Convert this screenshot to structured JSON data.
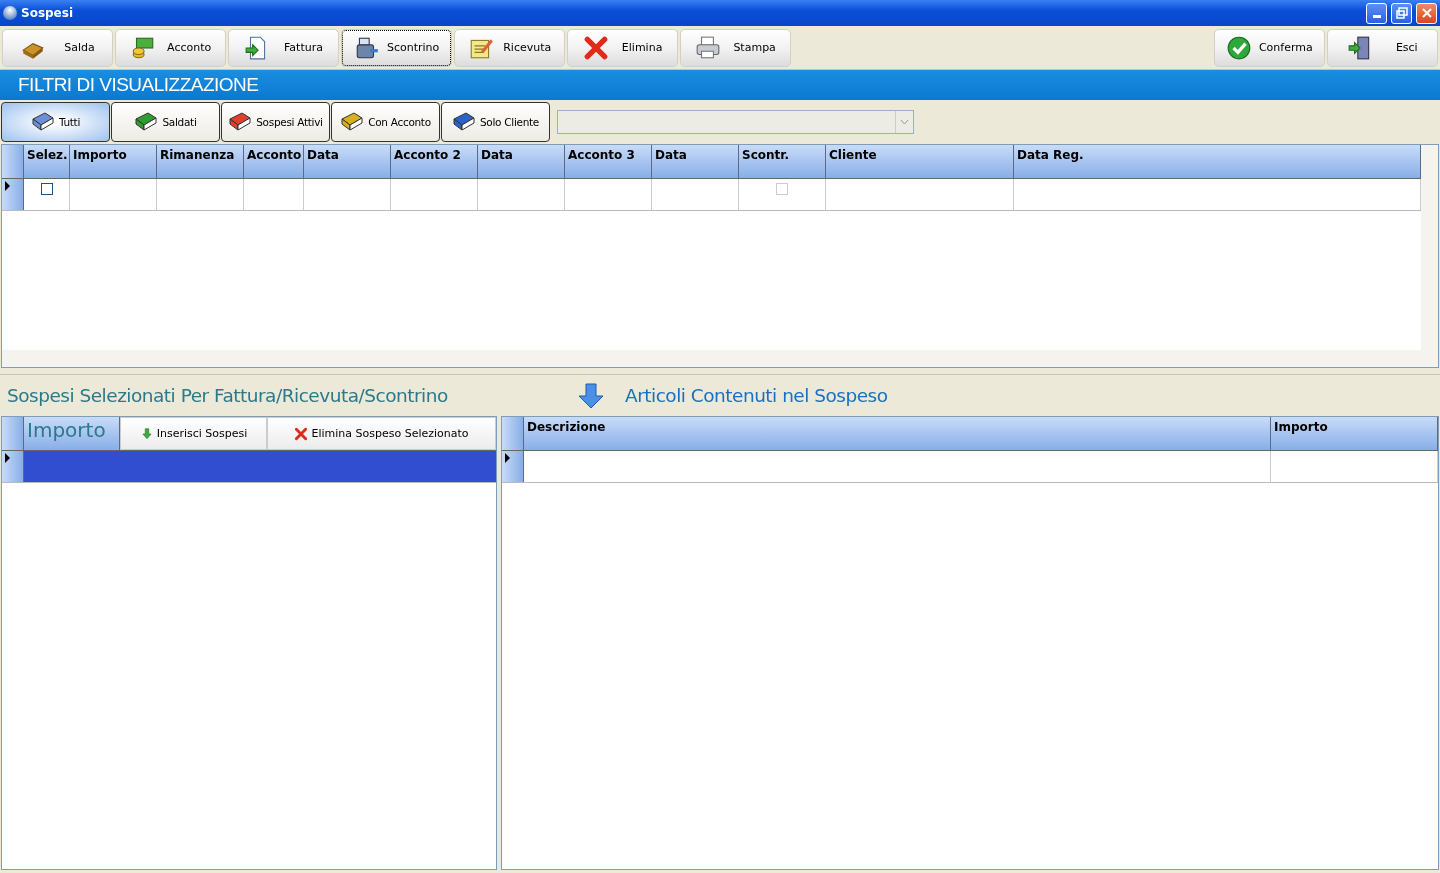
{
  "window": {
    "title": "Sospesi"
  },
  "toolbar": [
    {
      "label": "Salda",
      "kind": "gold",
      "focused": false
    },
    {
      "label": "Acconto",
      "kind": "money",
      "focused": false
    },
    {
      "label": "Fattura",
      "kind": "document",
      "focused": false
    },
    {
      "label": "Scontrino",
      "kind": "register",
      "focused": true
    },
    {
      "label": "Ricevuta",
      "kind": "notepad",
      "focused": false
    },
    {
      "label": "Elimina",
      "kind": "delete",
      "focused": false
    },
    {
      "label": "Stampa",
      "kind": "printer",
      "focused": false
    }
  ],
  "toolbar_right": [
    {
      "label": "Conferma",
      "kind": "check",
      "focused": false
    },
    {
      "label": "Esci",
      "kind": "exit",
      "focused": false
    }
  ],
  "filters": {
    "title": "FILTRI DI VISUALIZZAZIONE",
    "buttons": [
      {
        "label": "Tutti",
        "color": "#6b8fd8",
        "selected": true
      },
      {
        "label": "Saldati",
        "color": "#2e9e2e",
        "selected": false
      },
      {
        "label": "Sospesi Attivi",
        "color": "#e0402a",
        "selected": false
      },
      {
        "label": "Con Acconto",
        "color": "#d8b020",
        "selected": false
      },
      {
        "label": "Solo Cliente",
        "color": "#2a62c8",
        "selected": false
      }
    ]
  },
  "main_table": {
    "columns": [
      "Selez.",
      "Importo",
      "Rimanenza",
      "Acconto",
      "Data",
      "Acconto 2",
      "Data",
      "Acconto 3",
      "Data",
      "Scontr.",
      "Cliente",
      "Data Reg."
    ],
    "rows": [
      {
        "current": true,
        "selez_checked": false,
        "scontr_checked": false
      }
    ]
  },
  "selected_title": "Sospesi Selezionati Per Fattura/Ricevuta/Scontrino",
  "articles_title": "Articoli Contenuti nel Sospeso",
  "selected_table": {
    "column": "Importo",
    "buttons": [
      {
        "label": "Inserisci Sospesi",
        "kind": "insert"
      },
      {
        "label": "Elimina Sospeso Selezionato",
        "kind": "delete"
      }
    ],
    "rows": [
      {
        "current": true,
        "selected": true
      }
    ]
  },
  "articles_table": {
    "columns": [
      "Descrizione",
      "Importo"
    ],
    "rows": [
      {
        "current": true
      }
    ]
  }
}
